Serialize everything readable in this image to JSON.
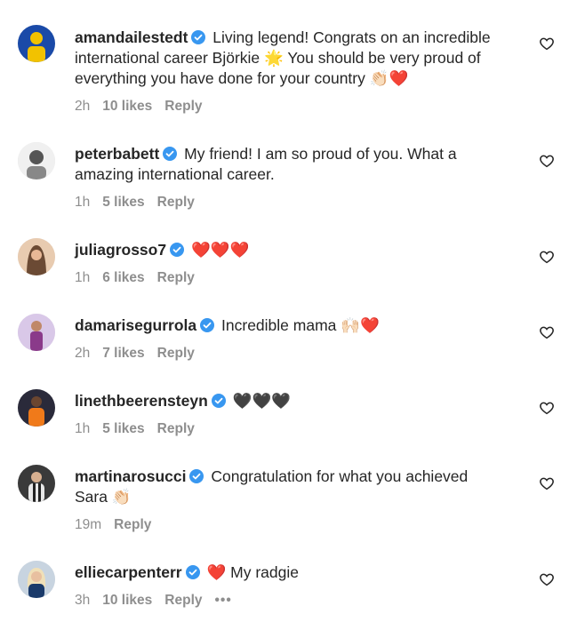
{
  "comments": [
    {
      "username": "amandailestedt",
      "text_lines": [
        "Living legend! Congrats on an incredible",
        "international career Björkie 🌟 You should be very proud of",
        "everything you have done for your country 👏🏻❤️"
      ],
      "time": "2h",
      "likes": "10 likes",
      "reply": "Reply",
      "avatar_colors": [
        "#1a4aa8",
        "#f2c200"
      ]
    },
    {
      "username": "peterbabett",
      "text_lines": [
        "My friend! I am so proud of you. What a",
        "amazing international career."
      ],
      "time": "1h",
      "likes": "5 likes",
      "reply": "Reply",
      "avatar_colors": [
        "#f0f0f0",
        "#555555"
      ]
    },
    {
      "username": "juliagrosso7",
      "text_lines": [
        "❤️❤️❤️"
      ],
      "time": "1h",
      "likes": "6 likes",
      "reply": "Reply",
      "avatar_colors": [
        "#e8cbb0",
        "#6b4a34"
      ]
    },
    {
      "username": "damarisegurrola",
      "text_lines": [
        "Incredible mama 🙌🏻❤️"
      ],
      "time": "2h",
      "likes": "7 likes",
      "reply": "Reply",
      "avatar_colors": [
        "#d9c8e8",
        "#8a3a8a"
      ]
    },
    {
      "username": "linethbeerensteyn",
      "text_lines": [
        "🖤🖤🖤"
      ],
      "time": "1h",
      "likes": "5 likes",
      "reply": "Reply",
      "avatar_colors": [
        "#2a2a3a",
        "#f07a1a"
      ]
    },
    {
      "username": "martinarosucci",
      "text_lines": [
        "Congratulation for what you achieved",
        "Sara 👏🏻"
      ],
      "time": "19m",
      "likes": "",
      "reply": "Reply",
      "avatar_colors": [
        "#3a3a3a",
        "#e8e8e8"
      ]
    },
    {
      "username": "elliecarpenterr",
      "text_lines": [
        "❤️ My radgie"
      ],
      "time": "3h",
      "likes": "10 likes",
      "reply": "Reply",
      "more": "•••",
      "avatar_colors": [
        "#c8d4e0",
        "#f0e0b8"
      ]
    }
  ],
  "colors": {
    "verified": "#3897f0",
    "meta": "#8e8e8e",
    "text": "#262626"
  },
  "icons": {
    "verified": "verified-badge-icon",
    "like": "heart-outline-icon"
  }
}
